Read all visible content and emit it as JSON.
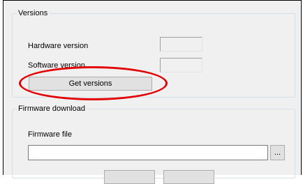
{
  "versions": {
    "title": "Versions",
    "hardware_label": "Hardware version",
    "hardware_value": "",
    "software_label": "Software version",
    "software_value": "",
    "get_versions_label": "Get versions"
  },
  "firmware": {
    "title": "Firmware download",
    "file_label": "Firmware file",
    "file_value": "",
    "browse_label": "...",
    "button1_label": "",
    "button2_label": ""
  },
  "colors": {
    "highlight": "#e30000",
    "panel": "#f0f0f0",
    "group_border": "#d5dfe5"
  }
}
